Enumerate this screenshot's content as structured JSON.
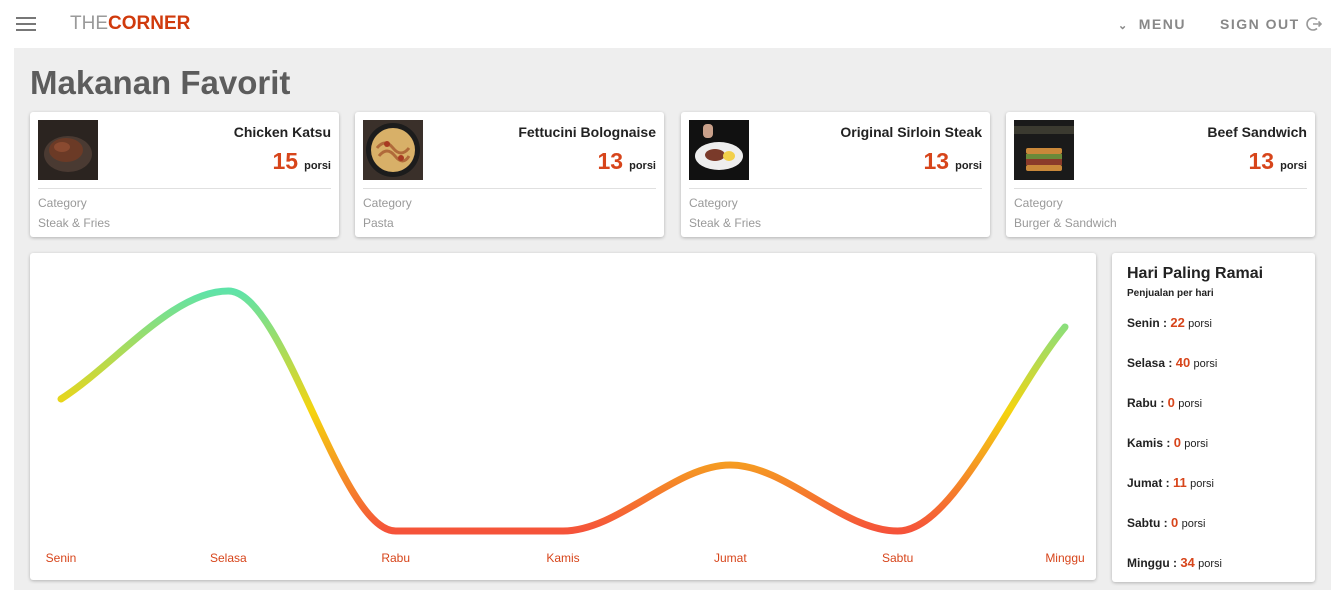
{
  "header": {
    "logo_part1": "THE",
    "logo_part2": "CORNER",
    "menu_label": "MENU",
    "signout_label": "SIGN OUT"
  },
  "page_title": "Makanan Favorit",
  "foods": [
    {
      "name": "Chicken Katsu",
      "count": "15",
      "unit": "porsi",
      "category_label": "Category",
      "category": "Steak & Fries"
    },
    {
      "name": "Fettucini Bolognaise",
      "count": "13",
      "unit": "porsi",
      "category_label": "Category",
      "category": "Pasta"
    },
    {
      "name": "Original Sirloin Steak",
      "count": "13",
      "unit": "porsi",
      "category_label": "Category",
      "category": "Steak & Fries"
    },
    {
      "name": "Beef Sandwich",
      "count": "13",
      "unit": "porsi",
      "category_label": "Category",
      "category": "Burger & Sandwich"
    }
  ],
  "busy_days": {
    "title": "Hari Paling Ramai",
    "subtitle": "Penjualan per hari",
    "unit": "porsi",
    "rows": [
      {
        "day": "Senin",
        "value": "22"
      },
      {
        "day": "Selasa",
        "value": "40"
      },
      {
        "day": "Rabu",
        "value": "0"
      },
      {
        "day": "Kamis",
        "value": "0"
      },
      {
        "day": "Jumat",
        "value": "11"
      },
      {
        "day": "Sabtu",
        "value": "0"
      },
      {
        "day": "Minggu",
        "value": "34"
      }
    ]
  },
  "chart_data": {
    "type": "line",
    "categories": [
      "Senin",
      "Selasa",
      "Rabu",
      "Kamis",
      "Jumat",
      "Sabtu",
      "Minggu"
    ],
    "values": [
      22,
      40,
      0,
      0,
      11,
      0,
      34
    ],
    "ylim": [
      0,
      40
    ],
    "grid": false,
    "colors": {
      "high": "#5fe3a8",
      "mid": "#f5d40e",
      "low": "#f5533a",
      "label": "#d7451b"
    }
  }
}
